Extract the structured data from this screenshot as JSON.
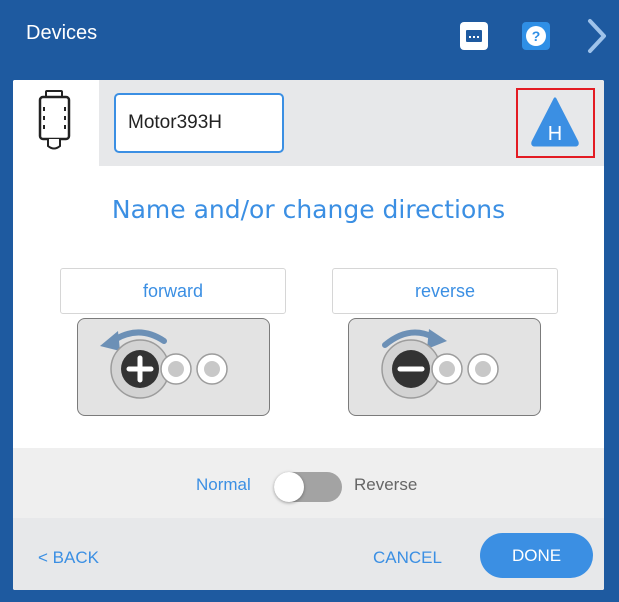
{
  "window": {
    "title": "Devices",
    "toolbar_icons": [
      "port-icon",
      "help-icon",
      "chevron-right-icon"
    ]
  },
  "device": {
    "name": "Motor393H",
    "icon": "motor-393-icon",
    "warning_letter": "H",
    "warning_icon": "warning-triangle-icon"
  },
  "heading": "Name and/or change directions",
  "directions": {
    "forward": {
      "label": "forward",
      "icon": "rotate-plus-icon"
    },
    "reverse": {
      "label": "reverse",
      "icon": "rotate-minus-icon"
    }
  },
  "toggle": {
    "left_label": "Normal",
    "right_label": "Reverse",
    "state": "Normal"
  },
  "footer": {
    "back": "< BACK",
    "cancel": "CANCEL",
    "done": "DONE"
  },
  "colors": {
    "titlebar": "#1e5aa0",
    "accent": "#3b8fe3",
    "highlight_box": "#e31b23"
  }
}
